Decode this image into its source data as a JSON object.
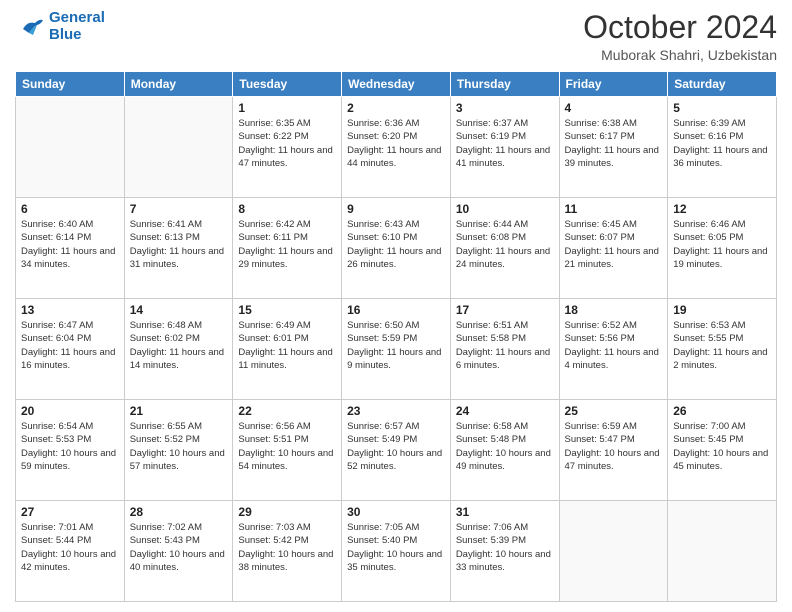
{
  "logo": {
    "line1": "General",
    "line2": "Blue"
  },
  "title": "October 2024",
  "location": "Muborak Shahri, Uzbekistan",
  "days_of_week": [
    "Sunday",
    "Monday",
    "Tuesday",
    "Wednesday",
    "Thursday",
    "Friday",
    "Saturday"
  ],
  "weeks": [
    [
      {
        "day": "",
        "info": ""
      },
      {
        "day": "",
        "info": ""
      },
      {
        "day": "1",
        "info": "Sunrise: 6:35 AM\nSunset: 6:22 PM\nDaylight: 11 hours and 47 minutes."
      },
      {
        "day": "2",
        "info": "Sunrise: 6:36 AM\nSunset: 6:20 PM\nDaylight: 11 hours and 44 minutes."
      },
      {
        "day": "3",
        "info": "Sunrise: 6:37 AM\nSunset: 6:19 PM\nDaylight: 11 hours and 41 minutes."
      },
      {
        "day": "4",
        "info": "Sunrise: 6:38 AM\nSunset: 6:17 PM\nDaylight: 11 hours and 39 minutes."
      },
      {
        "day": "5",
        "info": "Sunrise: 6:39 AM\nSunset: 6:16 PM\nDaylight: 11 hours and 36 minutes."
      }
    ],
    [
      {
        "day": "6",
        "info": "Sunrise: 6:40 AM\nSunset: 6:14 PM\nDaylight: 11 hours and 34 minutes."
      },
      {
        "day": "7",
        "info": "Sunrise: 6:41 AM\nSunset: 6:13 PM\nDaylight: 11 hours and 31 minutes."
      },
      {
        "day": "8",
        "info": "Sunrise: 6:42 AM\nSunset: 6:11 PM\nDaylight: 11 hours and 29 minutes."
      },
      {
        "day": "9",
        "info": "Sunrise: 6:43 AM\nSunset: 6:10 PM\nDaylight: 11 hours and 26 minutes."
      },
      {
        "day": "10",
        "info": "Sunrise: 6:44 AM\nSunset: 6:08 PM\nDaylight: 11 hours and 24 minutes."
      },
      {
        "day": "11",
        "info": "Sunrise: 6:45 AM\nSunset: 6:07 PM\nDaylight: 11 hours and 21 minutes."
      },
      {
        "day": "12",
        "info": "Sunrise: 6:46 AM\nSunset: 6:05 PM\nDaylight: 11 hours and 19 minutes."
      }
    ],
    [
      {
        "day": "13",
        "info": "Sunrise: 6:47 AM\nSunset: 6:04 PM\nDaylight: 11 hours and 16 minutes."
      },
      {
        "day": "14",
        "info": "Sunrise: 6:48 AM\nSunset: 6:02 PM\nDaylight: 11 hours and 14 minutes."
      },
      {
        "day": "15",
        "info": "Sunrise: 6:49 AM\nSunset: 6:01 PM\nDaylight: 11 hours and 11 minutes."
      },
      {
        "day": "16",
        "info": "Sunrise: 6:50 AM\nSunset: 5:59 PM\nDaylight: 11 hours and 9 minutes."
      },
      {
        "day": "17",
        "info": "Sunrise: 6:51 AM\nSunset: 5:58 PM\nDaylight: 11 hours and 6 minutes."
      },
      {
        "day": "18",
        "info": "Sunrise: 6:52 AM\nSunset: 5:56 PM\nDaylight: 11 hours and 4 minutes."
      },
      {
        "day": "19",
        "info": "Sunrise: 6:53 AM\nSunset: 5:55 PM\nDaylight: 11 hours and 2 minutes."
      }
    ],
    [
      {
        "day": "20",
        "info": "Sunrise: 6:54 AM\nSunset: 5:53 PM\nDaylight: 10 hours and 59 minutes."
      },
      {
        "day": "21",
        "info": "Sunrise: 6:55 AM\nSunset: 5:52 PM\nDaylight: 10 hours and 57 minutes."
      },
      {
        "day": "22",
        "info": "Sunrise: 6:56 AM\nSunset: 5:51 PM\nDaylight: 10 hours and 54 minutes."
      },
      {
        "day": "23",
        "info": "Sunrise: 6:57 AM\nSunset: 5:49 PM\nDaylight: 10 hours and 52 minutes."
      },
      {
        "day": "24",
        "info": "Sunrise: 6:58 AM\nSunset: 5:48 PM\nDaylight: 10 hours and 49 minutes."
      },
      {
        "day": "25",
        "info": "Sunrise: 6:59 AM\nSunset: 5:47 PM\nDaylight: 10 hours and 47 minutes."
      },
      {
        "day": "26",
        "info": "Sunrise: 7:00 AM\nSunset: 5:45 PM\nDaylight: 10 hours and 45 minutes."
      }
    ],
    [
      {
        "day": "27",
        "info": "Sunrise: 7:01 AM\nSunset: 5:44 PM\nDaylight: 10 hours and 42 minutes."
      },
      {
        "day": "28",
        "info": "Sunrise: 7:02 AM\nSunset: 5:43 PM\nDaylight: 10 hours and 40 minutes."
      },
      {
        "day": "29",
        "info": "Sunrise: 7:03 AM\nSunset: 5:42 PM\nDaylight: 10 hours and 38 minutes."
      },
      {
        "day": "30",
        "info": "Sunrise: 7:05 AM\nSunset: 5:40 PM\nDaylight: 10 hours and 35 minutes."
      },
      {
        "day": "31",
        "info": "Sunrise: 7:06 AM\nSunset: 5:39 PM\nDaylight: 10 hours and 33 minutes."
      },
      {
        "day": "",
        "info": ""
      },
      {
        "day": "",
        "info": ""
      }
    ]
  ]
}
